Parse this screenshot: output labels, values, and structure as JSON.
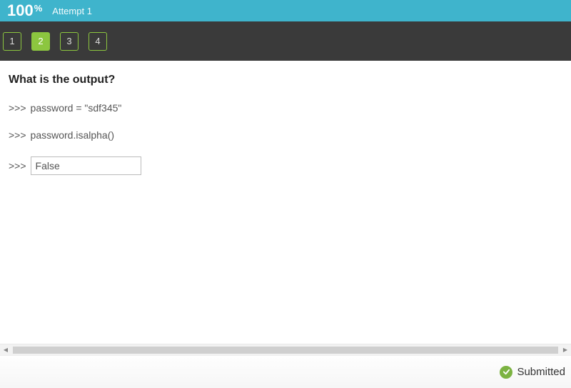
{
  "header": {
    "score_value": "100",
    "score_pct": "%",
    "attempt_label": "Attempt 1"
  },
  "nav": {
    "items": [
      "1",
      "2",
      "3",
      "4"
    ],
    "active_index": 1
  },
  "question": {
    "title": "What is the output?",
    "lines": [
      {
        "prompt": ">>>",
        "text": "password = \"sdf345\""
      },
      {
        "prompt": ">>>",
        "text": "password.isalpha()"
      }
    ],
    "answer_prompt": ">>>",
    "answer_value": "False"
  },
  "footer": {
    "status_label": "Submitted"
  }
}
